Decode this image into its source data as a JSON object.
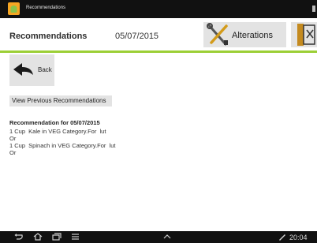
{
  "status_bar": {
    "app_title": "Recommendations",
    "app_icon": "android-icon"
  },
  "header": {
    "title": "Recommendations",
    "date": "05/07/2015",
    "alterations_label": "Alterations",
    "alterations_icon": "tools-icon",
    "exit_icon": "exit-door-icon"
  },
  "accent_color": "#9ccf36",
  "back": {
    "label": "Back",
    "icon": "back-arrow-icon"
  },
  "view_previous_label": "View Previous Recommendations",
  "recommendation": {
    "heading": "Recommendation for 05/07/2015",
    "lines": [
      "1 Cup  Kale in VEG Category.For  lut",
      "Or",
      "1 Cup  Spinach in VEG Category.For  lut",
      "Or"
    ]
  },
  "nav_bar": {
    "time": "20:04"
  }
}
